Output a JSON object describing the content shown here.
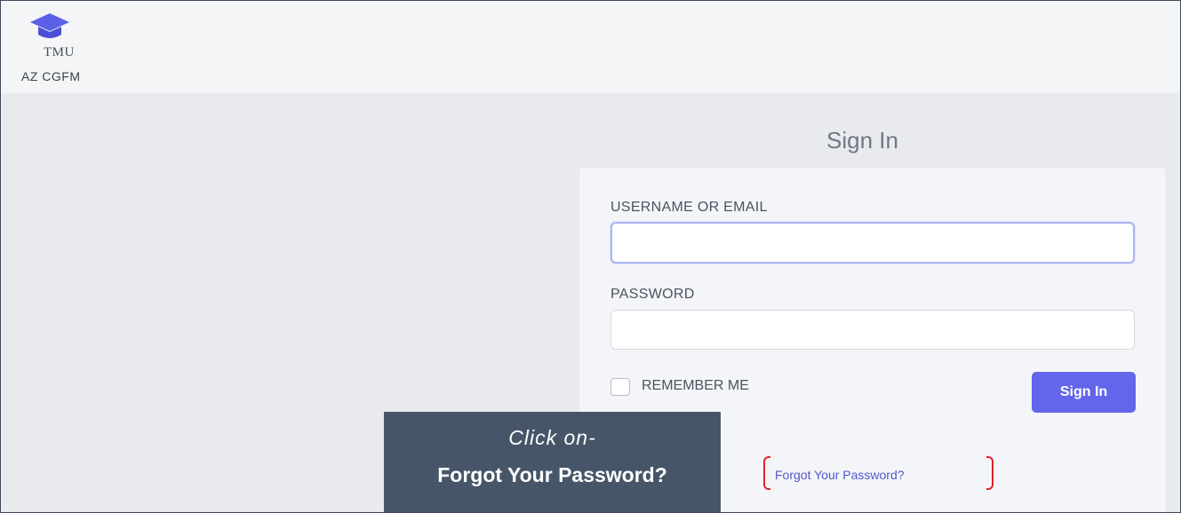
{
  "brand": {
    "logo_text": "TMU",
    "org_name": "AZ CGFM",
    "icon": "graduation-cap-icon",
    "icon_color": "#5b61e6"
  },
  "signin": {
    "title": "Sign In",
    "username_label": "USERNAME OR EMAIL",
    "username_value": "",
    "password_label": "PASSWORD",
    "password_value": "",
    "remember_label": "REMEMBER ME",
    "remember_checked": false,
    "submit_label": "Sign In",
    "forgot_label": "Forgot Your Password?"
  },
  "callout": {
    "line1": "Click on-",
    "line2": "Forgot Your Password?"
  },
  "colors": {
    "accent": "#6366ea",
    "link": "#5257c9",
    "highlight": "#e1232b",
    "callout_bg": "#475568"
  }
}
